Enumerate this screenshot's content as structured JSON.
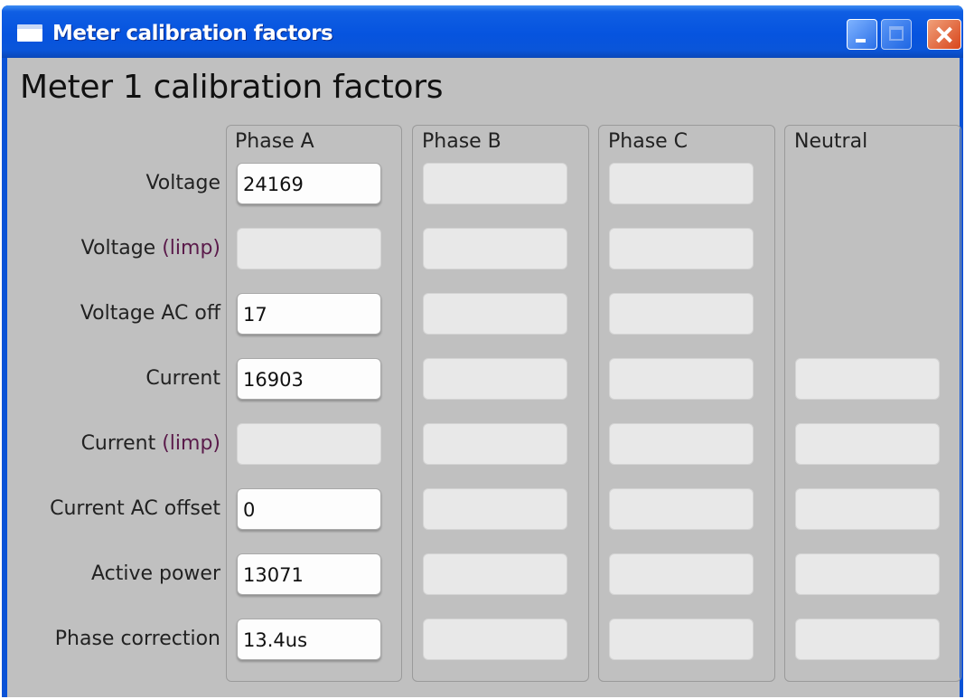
{
  "window": {
    "title": "Meter calibration factors",
    "controls": [
      "minimize-icon",
      "maximize-icon",
      "close-icon"
    ]
  },
  "page_title": "Meter 1 calibration factors",
  "columns": [
    "Phase A",
    "Phase B",
    "Phase C",
    "Neutral"
  ],
  "rows": [
    {
      "label_main": "Voltage",
      "label_paren": "",
      "values": {
        "phase_a": "24169"
      }
    },
    {
      "label_main": "Voltage",
      "label_paren": "(limp)",
      "values": {
        "phase_a": ""
      }
    },
    {
      "label_main": "Voltage AC off",
      "label_paren": "",
      "values": {
        "phase_a": "17"
      }
    },
    {
      "label_main": "Current",
      "label_paren": "",
      "values": {
        "phase_a": "16903"
      }
    },
    {
      "label_main": "Current",
      "label_paren": "(limp)",
      "values": {
        "phase_a": ""
      }
    },
    {
      "label_main": "Current AC offset",
      "label_paren": "",
      "values": {
        "phase_a": "0"
      }
    },
    {
      "label_main": "Active power",
      "label_paren": "",
      "values": {
        "phase_a": "13071"
      }
    },
    {
      "label_main": "Phase correction",
      "label_paren": "",
      "values": {
        "phase_a": "13.4us"
      }
    }
  ],
  "colors": {
    "titlebar": "#0654df",
    "client_bg": "#c0c0c0",
    "field_enabled": "#fdfdfd",
    "field_disabled": "#e8e8e8",
    "limp_text": "#5a1a4a"
  }
}
